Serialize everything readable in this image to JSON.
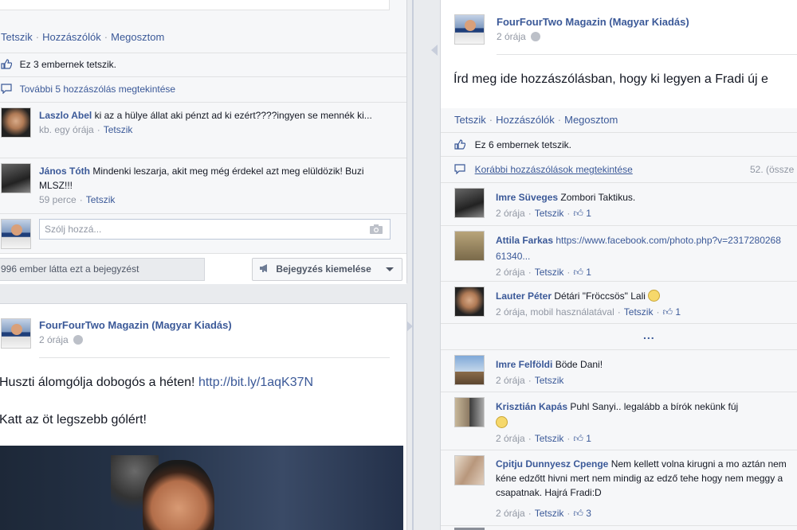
{
  "colors": {
    "link": "#3b5998",
    "meta": "#9197a3",
    "background": "#e9ebee"
  },
  "left_post_1": {
    "actions": {
      "like": "Tetszik",
      "comment": "Hozzászólók",
      "share": "Megosztom",
      "sep": "·"
    },
    "likes_text": "Ez 3 embernek tetszik.",
    "more_comments": "További 5 hozzászólás megtekintése",
    "comments": [
      {
        "name": "Laszlo Abel",
        "text": "ki az a hülye állat aki pénzt ad ki ezért????ingyen se mennék ki...",
        "time": "kb. egy órája",
        "like": "Tetszik"
      },
      {
        "name": "János Tóth",
        "text": "Mindenki leszarja, akit meg még érdekel azt meg elüldözik! Buzi MLSZ!!!",
        "time": "59 perce",
        "like": "Tetszik"
      }
    ],
    "comment_placeholder": "Szólj hozzá...",
    "seen_text": "996 ember látta ezt a bejegyzést",
    "promote_label": "Bejegyzés kiemelése"
  },
  "left_post_2": {
    "author": "FourFourTwo Magazin (Magyar Kiadás)",
    "time": "2 órája",
    "text_1": "Huszti álomgólja dobogós a héten!",
    "link": "http://bit.ly/1aqK37N",
    "text_2": "Katt az öt legszebb gólért!"
  },
  "right_post": {
    "author": "FourFourTwo Magazin (Magyar Kiadás)",
    "time": "2 órája",
    "text": "Írd meg ide hozzászólásban, hogy ki legyen a Fradi új e",
    "actions": {
      "like": "Tetszik",
      "comment": "Hozzászólók",
      "share": "Megosztom",
      "sep": "·"
    },
    "likes_text": "Ez 6 embernek tetszik.",
    "earlier_comments": "Korábbi hozzászólások megtekintése",
    "count_text": "52. (össze",
    "ellipsis": "...",
    "comments": [
      {
        "name": "Imre Süveges",
        "text": "Zombori Taktikus.",
        "time": "2 órája",
        "like": "Tetszik",
        "likes": "1"
      },
      {
        "name": "Attila Farkas",
        "text": "https://www.facebook.com/photo.php?v=231728026861340...",
        "time": "2 órája",
        "like": "Tetszik",
        "likes": "1"
      },
      {
        "name": "Lauter Péter",
        "text": "Détári \"Fröccsös\" Lali",
        "time": "2 órája, mobil használatával",
        "like": "Tetszik",
        "likes": "1"
      },
      {
        "name": "Imre Felföldi",
        "text": "Böde Dani!",
        "time": "2 órája",
        "like": "Tetszik",
        "likes": ""
      },
      {
        "name": "Krisztián Kapás",
        "text": "Puhl Sanyi.. legalább a bírók nekünk fúj",
        "time": "2 órája",
        "like": "Tetszik",
        "likes": "1"
      },
      {
        "name": "Cpitju Dunnyesz Cpenge",
        "text": "Nem kellett volna kirugni a mo aztán nem kéne edzőtt hivni mert nem mindig az edző tehe hogy nem meggy a csapatnak. Hajrá Fradi:D",
        "time": "2 órája",
        "like": "Tetszik",
        "likes": "3"
      }
    ]
  }
}
